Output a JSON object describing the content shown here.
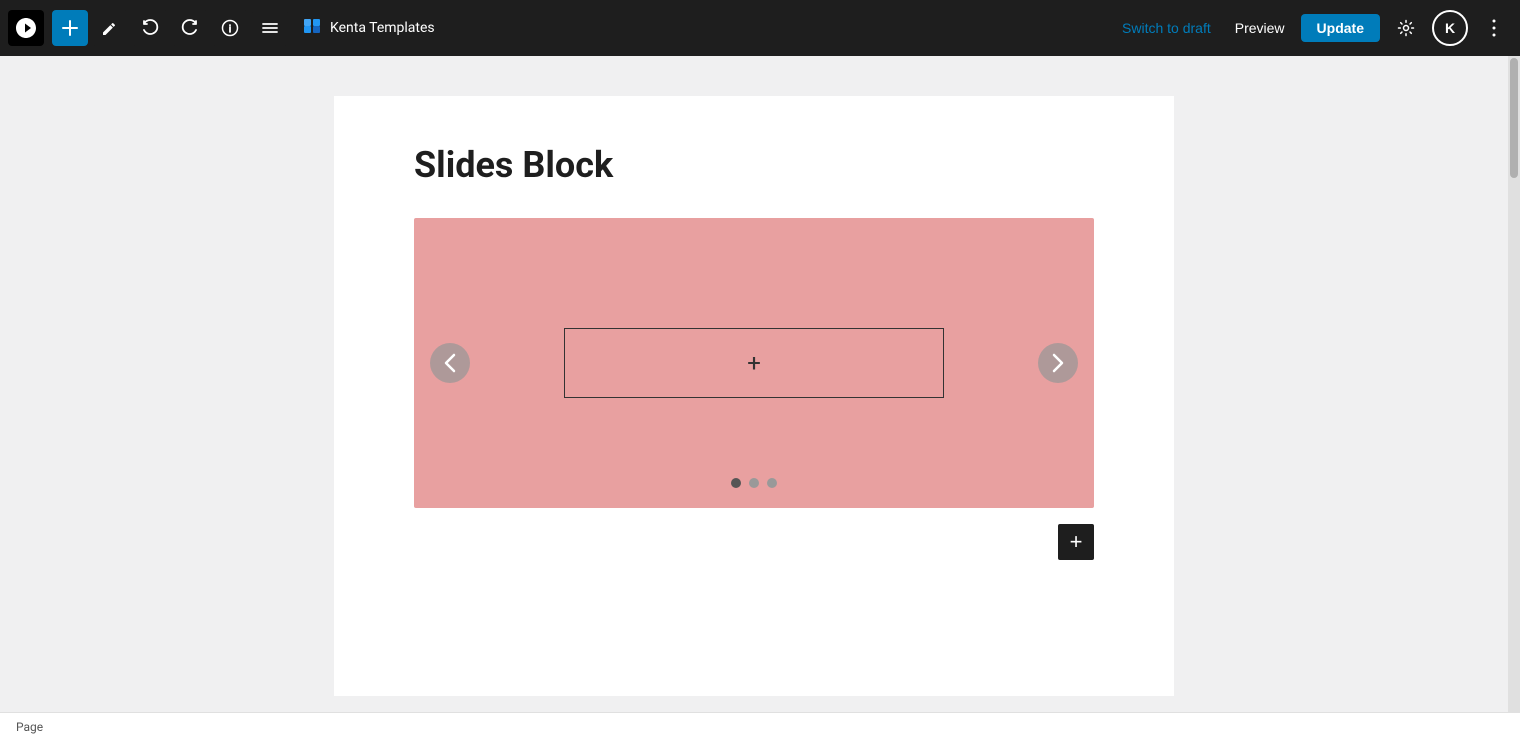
{
  "toolbar": {
    "add_label": "+",
    "plugin_name": "Kenta Templates",
    "switch_to_draft_label": "Switch to draft",
    "preview_label": "Preview",
    "update_label": "Update",
    "user_initial": "K"
  },
  "page": {
    "title": "Slides Block",
    "type_label": "Page"
  },
  "slider": {
    "add_inner_label": "+",
    "dots": [
      1,
      2,
      3
    ],
    "slide_bg_color": "#e8a0a0"
  },
  "add_block": {
    "label": "+"
  }
}
